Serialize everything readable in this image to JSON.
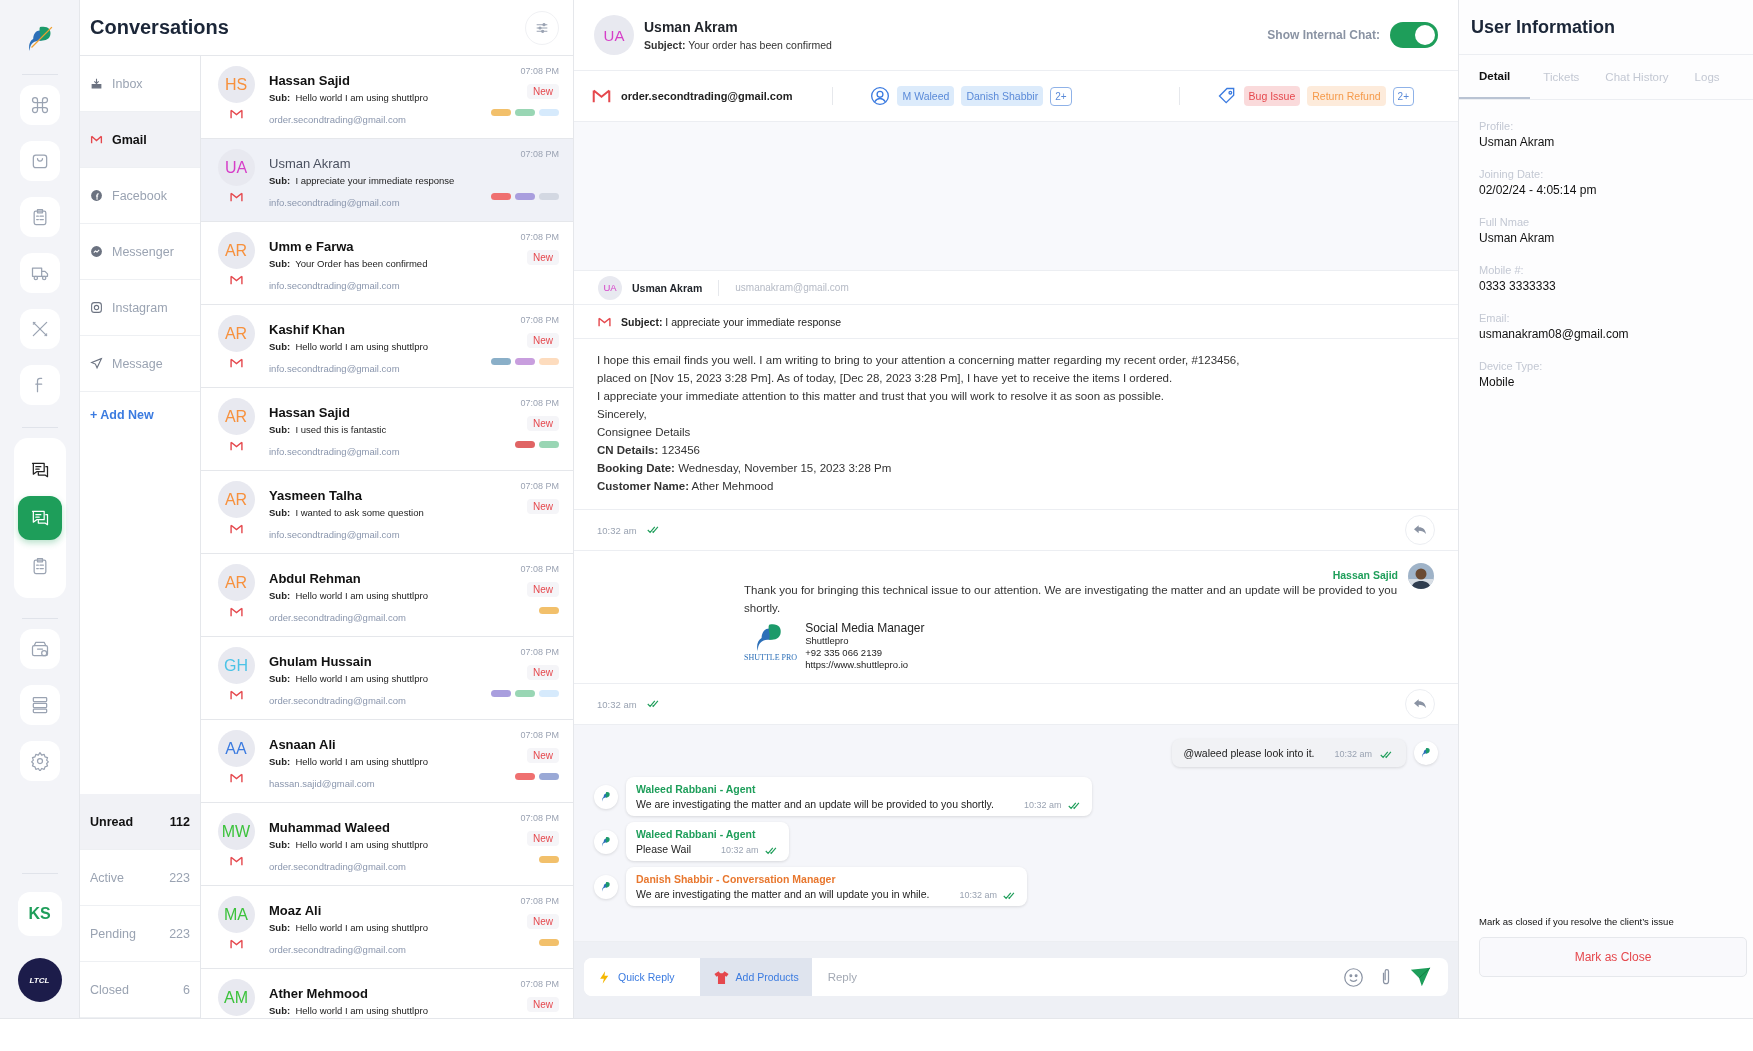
{
  "rail": {
    "items": [
      {
        "selected": false
      },
      {
        "selected": false
      },
      {
        "selected": false
      },
      {
        "selected": false
      },
      {
        "selected": false
      },
      {
        "selected": false
      },
      {
        "selected": false
      },
      {
        "selected": true
      },
      {
        "selected": false
      },
      {
        "selected": false
      },
      {
        "selected": false
      },
      {
        "selected": false
      }
    ],
    "user_initials": "KS",
    "brand_badge": "LTCL"
  },
  "conversations": {
    "title": "Conversations",
    "channels": [
      {
        "label": "Inbox",
        "selected": false
      },
      {
        "label": "Gmail",
        "selected": true
      },
      {
        "label": "Facebook",
        "selected": false
      },
      {
        "label": "Messenger",
        "selected": false
      },
      {
        "label": "Instagram",
        "selected": false
      },
      {
        "label": "Message",
        "selected": false
      }
    ],
    "add_new": "+ Add New",
    "statuses": [
      {
        "label": "Unread",
        "count": "112",
        "selected": true
      },
      {
        "label": "Active",
        "count": "223",
        "selected": false
      },
      {
        "label": "Pending",
        "count": "223",
        "selected": false
      },
      {
        "label": "Closed",
        "count": "6",
        "selected": false
      }
    ],
    "items": [
      {
        "initials": "HS",
        "color": "#f7913d",
        "name": "Hassan Sajid",
        "sub_label": "Sub:",
        "subject": "Hello world I am using shuttlpro",
        "email": "order.secondtrading@gmail.com",
        "time": "07:08 PM",
        "badge": "New",
        "unread": true,
        "selected": false,
        "tags": [
          {
            "color": "#f2c06b"
          },
          {
            "color": "#99d6b4"
          },
          {
            "color": "#d6eafc"
          }
        ]
      },
      {
        "initials": "UA",
        "color": "#d63fc8",
        "name": "Usman Akram",
        "sub_label": "Sub:",
        "subject": "I appreciate your immediate response",
        "email": "info.secondtrading@gmail.com",
        "time": "07:08 PM",
        "unread": false,
        "selected": true,
        "tags": [
          {
            "color": "#ef7070"
          },
          {
            "color": "#a99ede"
          },
          {
            "color": "#d3d8e2"
          }
        ]
      },
      {
        "initials": "AR",
        "color": "#f7913d",
        "name": "Umm e Farwa",
        "sub_label": "Sub:",
        "subject": "Your Order has been confirmed",
        "email": "info.secondtrading@gmail.com",
        "time": "07:08 PM",
        "badge": "New",
        "unread": true,
        "selected": false
      },
      {
        "initials": "AR",
        "color": "#f7913d",
        "name": "Kashif Khan",
        "sub_label": "Sub:",
        "subject": "Hello world I am using shuttlpro",
        "email": "info.secondtrading@gmail.com",
        "time": "07:08 PM",
        "badge": "New",
        "unread": true,
        "selected": false,
        "tags": [
          {
            "color": "#8aafc8"
          },
          {
            "color": "#c89ede"
          },
          {
            "color": "#fddcbe"
          }
        ]
      },
      {
        "initials": "AR",
        "color": "#f7913d",
        "name": "Hassan Sajid",
        "sub_label": "Sub:",
        "subject": "I used this is fantastic",
        "email": "info.secondtrading@gmail.com",
        "time": "07:08 PM",
        "badge": "New",
        "unread": true,
        "selected": false,
        "tags": [
          {
            "color": "#e06464"
          },
          {
            "color": "#99d6b4"
          }
        ]
      },
      {
        "initials": "AR",
        "color": "#f7913d",
        "name": "Yasmeen Talha",
        "sub_label": "Sub:",
        "subject": "I wanted to ask some question",
        "email": "info.secondtrading@gmail.com",
        "time": "07:08 PM",
        "badge": "New",
        "unread": true,
        "selected": false
      },
      {
        "initials": "AR",
        "color": "#f7913d",
        "name": "Abdul Rehman",
        "sub_label": "Sub:",
        "subject": "Hello world I am using shuttlpro",
        "email": "order.secondtrading@gmail.com",
        "time": "07:08 PM",
        "badge": "New",
        "unread": true,
        "selected": false,
        "tags": [
          {
            "color": "#f2c06b"
          }
        ]
      },
      {
        "initials": "GH",
        "color": "#4cc3e6",
        "name": "Ghulam Hussain",
        "sub_label": "Sub:",
        "subject": "Hello world I am using shuttlpro",
        "email": "order.secondtrading@gmail.com",
        "time": "07:08 PM",
        "badge": "New",
        "unread": true,
        "selected": false,
        "tags": [
          {
            "color": "#a99ede"
          },
          {
            "color": "#99d6b4"
          },
          {
            "color": "#d6eafc"
          }
        ]
      },
      {
        "initials": "AA",
        "color": "#3b7be0",
        "name": "Asnaan Ali",
        "sub_label": "Sub:",
        "subject": "Hello world I am using shuttlpro",
        "email": "hassan.sajid@gmail.com",
        "time": "07:08 PM",
        "badge": "New",
        "unread": true,
        "selected": false,
        "tags": [
          {
            "color": "#ef7070"
          },
          {
            "color": "#9aa9d6"
          }
        ]
      },
      {
        "initials": "MW",
        "color": "#3cc23c",
        "name": "Muhammad Waleed",
        "sub_label": "Sub:",
        "subject": "Hello world I am using shuttlpro",
        "email": "order.secondtrading@gmail.com",
        "time": "07:08 PM",
        "badge": "New",
        "unread": true,
        "selected": false,
        "tags": [
          {
            "color": "#f2c06b"
          }
        ]
      },
      {
        "initials": "MA",
        "color": "#3cc23c",
        "name": "Moaz Ali",
        "sub_label": "Sub:",
        "subject": "Hello world I am using shuttlpro",
        "email": "order.secondtrading@gmail.com",
        "time": "07:08 PM",
        "badge": "New",
        "unread": true,
        "selected": false,
        "tags": [
          {
            "color": "#f2c06b"
          }
        ]
      },
      {
        "initials": "AM",
        "color": "#3cc23c",
        "name": "Ather Mehmood",
        "sub_label": "Sub:",
        "subject": "Hello world I am using shuttlpro",
        "time": "07:08 PM",
        "badge": "New",
        "unread": true,
        "selected": false
      }
    ]
  },
  "chat": {
    "initials": "UA",
    "name": "Usman Akram",
    "subject": "**Subject:** Your order has been confirmed",
    "internal_chat": {
      "label": "Show Internal Chat:",
      "on": true
    },
    "email": "order.secondtrading@gmail.com",
    "assignees": [
      {
        "label": "M Waleed"
      },
      {
        "label": "Danish Shabbir"
      }
    ],
    "assignees_more": "2+",
    "tags": [
      {
        "label": "Bug Issue",
        "color": "#e5484d"
      },
      {
        "label": "Return Refund",
        "color": "#f59a4a"
      }
    ],
    "tags_more": "2+",
    "mail": {
      "initials": "UA",
      "sender": "Usman Akram",
      "sender_email": "usmanakram@gmail.com",
      "subject": "**Subject:**  I appreciate your immediate response",
      "body": [
        "I hope this email finds you well. I am writing to bring to your attention a concerning matter regarding my recent order, #123456,",
        "placed on [Nov 15, 2023 3:28 Pm]. As of today, [Dec 28, 2023 3:28 Pm], I have yet to receive the items I ordered.",
        "I appreciate your immediate attention to this matter and trust that you will work to resolve it as soon as possible.",
        "Sincerely,",
        "Consignee Details",
        "**CN Details:** 123456",
        "**Booking Date:** Wednesday, November 15, 2023 3:28 Pm",
        "**Customer Name:** Ather Mehmood"
      ],
      "time": "10:32 am"
    },
    "reply": {
      "author": "Hassan Sajid",
      "text": "Thank you for bringing this technical issue to our attention. We are investigating the matter and an update will be provided to you shortly.",
      "signature": {
        "logo_text": "SHUTTLE PRO",
        "title": "Social Media Manager",
        "company": "Shuttlepro",
        "phone": "+92 335 066 2139",
        "url": "https://www.shuttlepro.io"
      },
      "time": "10:32 am"
    },
    "messages": [
      {
        "kind": "outgoing",
        "text": "@waleed please look into it.",
        "time": "10:32 am"
      },
      {
        "kind": "incoming",
        "sender": "Waleed Rabbani - Agent",
        "color": "#1e9e5a",
        "text": "We are investigating the matter and an update will be provided to you shortly.",
        "time": "10:32 am"
      },
      {
        "kind": "incoming",
        "sender": "Waleed Rabbani - Agent",
        "color": "#1e9e5a",
        "text": "Please Wail",
        "time": "10:32 am"
      },
      {
        "kind": "incoming",
        "sender": "Danish Shabbir - Conversation Manager",
        "color": "#e8772e",
        "text": "We are investigating the matter and an will update you in while.",
        "time": "10:32 am"
      }
    ],
    "composer": {
      "actions": [
        {
          "label": "Quick Reply",
          "selected": false
        },
        {
          "label": "Add Products",
          "selected": true
        }
      ],
      "placeholder": "Reply"
    }
  },
  "user_info": {
    "title": "User Information",
    "tabs": [
      {
        "label": "Detail",
        "selected": true
      },
      {
        "label": "Tickets",
        "selected": false
      },
      {
        "label": "Chat History",
        "selected": false
      },
      {
        "label": "Logs",
        "selected": false
      }
    ],
    "fields": [
      {
        "label": "Profile:",
        "value": "Usman Akram"
      },
      {
        "label": "Joining Date:",
        "value": "02/02/24  -  4:05:14 pm"
      },
      {
        "label": "Full Nmae",
        "value": "Usman Akram"
      },
      {
        "label": "Mobile #:",
        "value": "0333 3333333"
      },
      {
        "label": "Email:",
        "value": "usmanakram08@gmail.com"
      },
      {
        "label": "Device Type:",
        "value": "Mobile"
      }
    ],
    "note": "Mark as closed if you resolve the client’s issue",
    "close_button": "Mark as Close"
  }
}
